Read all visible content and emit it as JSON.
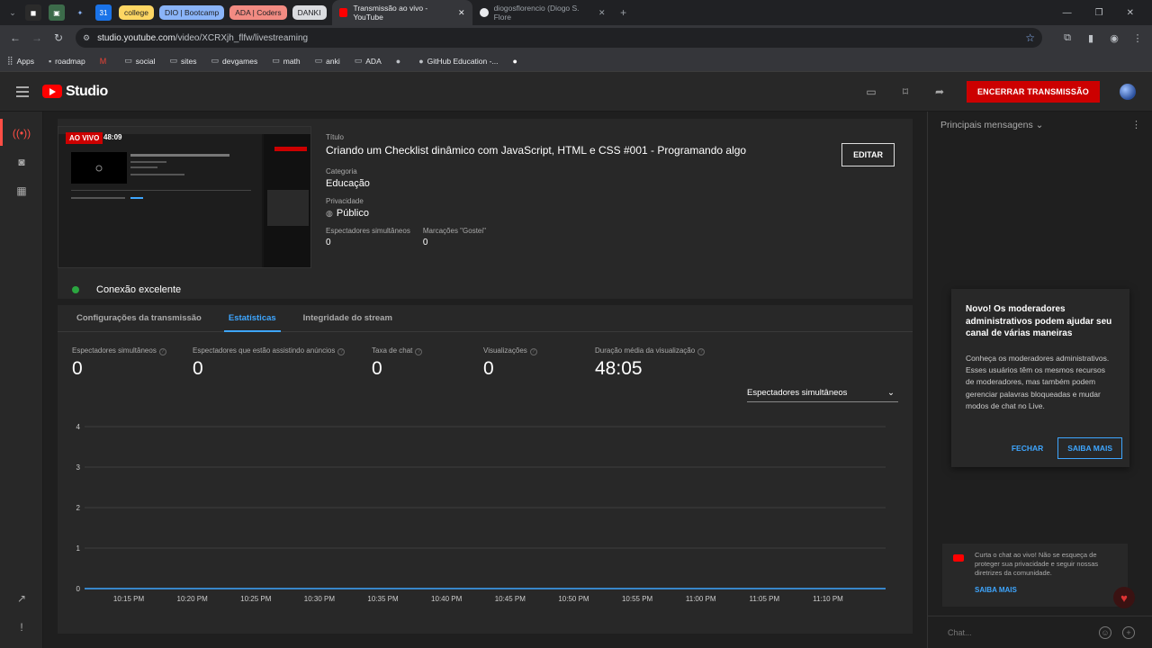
{
  "browser": {
    "pinned": [
      "college",
      "DIO | Bootcamp",
      "ADA | Coders",
      "DANKI"
    ],
    "tabs": [
      {
        "title": "Transmissão ao vivo - YouTube"
      },
      {
        "title": "diogosflorencio (Diogo S. Flore"
      }
    ],
    "url_host": "studio.youtube.com",
    "url_path": "/video/XCRXjh_flfw/livestreaming",
    "bookmarks": [
      "Apps",
      "roadmap",
      "social",
      "sites",
      "devgames",
      "math",
      "anki",
      "ADA",
      "GitHub Education -..."
    ]
  },
  "studio": {
    "logo_text": "Studio",
    "end_button": "ENCERRAR TRANSMISSÃO"
  },
  "stream": {
    "live_badge": "AO VIVO",
    "live_time": "48:09",
    "title_label": "Título",
    "title": "Criando um Checklist dinâmico com JavaScript, HTML e CSS #001 - Programando algo",
    "category_label": "Categoria",
    "category": "Educação",
    "privacy_label": "Privacidade",
    "privacy": "Público",
    "concurrent_label": "Espectadores simultâneos",
    "concurrent": "0",
    "likes_label": "Marcações \"Gostei\"",
    "likes": "0",
    "edit_button": "EDITAR",
    "connection": "Conexão excelente",
    "connection_color": "#2ba640"
  },
  "tabs": [
    "Configurações da transmissão",
    "Estatísticas",
    "Integridade do stream"
  ],
  "metrics": [
    {
      "label": "Espectadores simultâneos",
      "value": "0"
    },
    {
      "label": "Espectadores que estão assistindo anúncios",
      "value": "0"
    },
    {
      "label": "Taxa de chat",
      "value": "0"
    },
    {
      "label": "Visualizações",
      "value": "0"
    },
    {
      "label": "Duração média da visualização",
      "value": "48:05"
    }
  ],
  "metric_select": "Espectadores simultâneos",
  "chart_data": {
    "type": "line",
    "x": [
      "10:15 PM",
      "10:20 PM",
      "10:25 PM",
      "10:30 PM",
      "10:35 PM",
      "10:40 PM",
      "10:45 PM",
      "10:50 PM",
      "10:55 PM",
      "11:00 PM",
      "11:05 PM",
      "11:10 PM"
    ],
    "y_ticks": [
      0,
      1,
      2,
      3,
      4
    ],
    "ylim": [
      0,
      4
    ],
    "series": [
      {
        "values": [
          0,
          0,
          0,
          0,
          0,
          0,
          0,
          0,
          0,
          0,
          0,
          0
        ],
        "color": "#3ea6ff"
      }
    ],
    "grid": true
  },
  "chat": {
    "header": "Principais mensagens",
    "popup_title": "Novo! Os moderadores administrativos podem ajudar seu canal de várias maneiras",
    "popup_body": "Conheça os moderadores administrativos. Esses usuários têm os mesmos recursos de moderadores, mas também podem gerenciar palavras bloqueadas e mudar modos de chat no Live.",
    "popup_close": "FECHAR",
    "popup_more": "SAIBA MAIS",
    "notice_text": "Curta o chat ao vivo! Não se esqueça de proteger sua privacidade e seguir nossas diretrizes da comunidade.",
    "notice_link": "SAIBA MAIS",
    "input_placeholder": "Chat..."
  }
}
